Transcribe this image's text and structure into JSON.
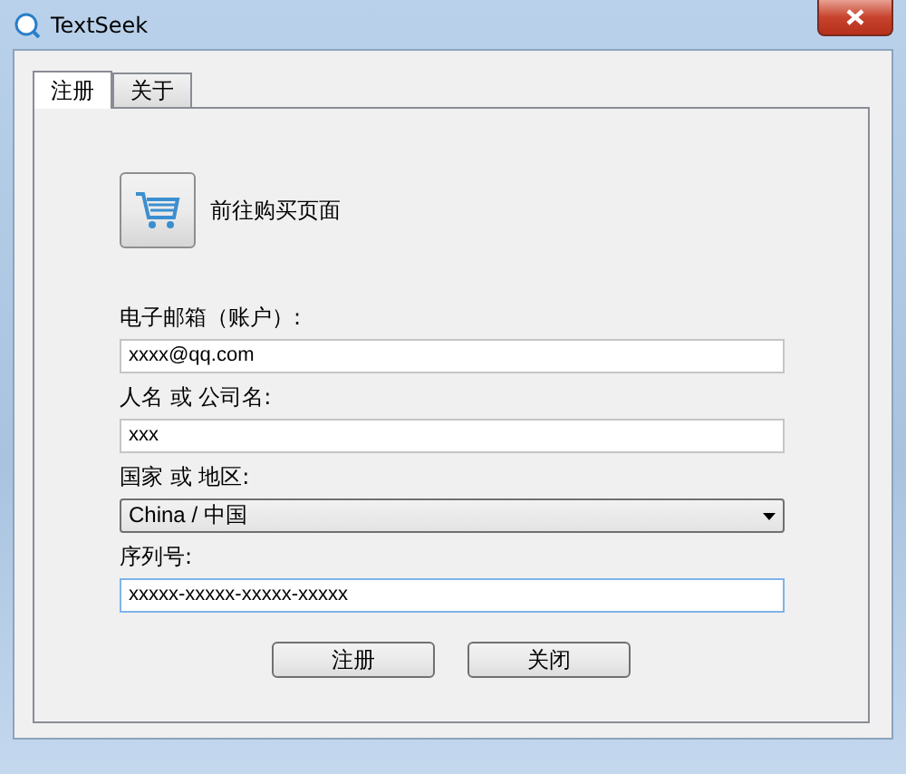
{
  "window": {
    "title": "TextSeek"
  },
  "tabs": [
    {
      "label": "注册",
      "selected": true
    },
    {
      "label": "关于",
      "selected": false
    }
  ],
  "buy_link": {
    "label": "前往购买页面"
  },
  "fields": [
    {
      "kind": "input",
      "label": "电子邮箱（账户）:",
      "value": "xxxx@qq.com",
      "focused": false
    },
    {
      "kind": "input",
      "label": "人名 或 公司名:",
      "value": "xxx",
      "focused": false
    },
    {
      "kind": "select",
      "label": "国家 或 地区:",
      "value": "China / 中国",
      "focused": false
    },
    {
      "kind": "input",
      "label": "序列号:",
      "value": "xxxxx-xxxxx-xxxxx-xxxxx",
      "focused": true
    }
  ],
  "buttons": [
    "注册",
    "关闭"
  ]
}
